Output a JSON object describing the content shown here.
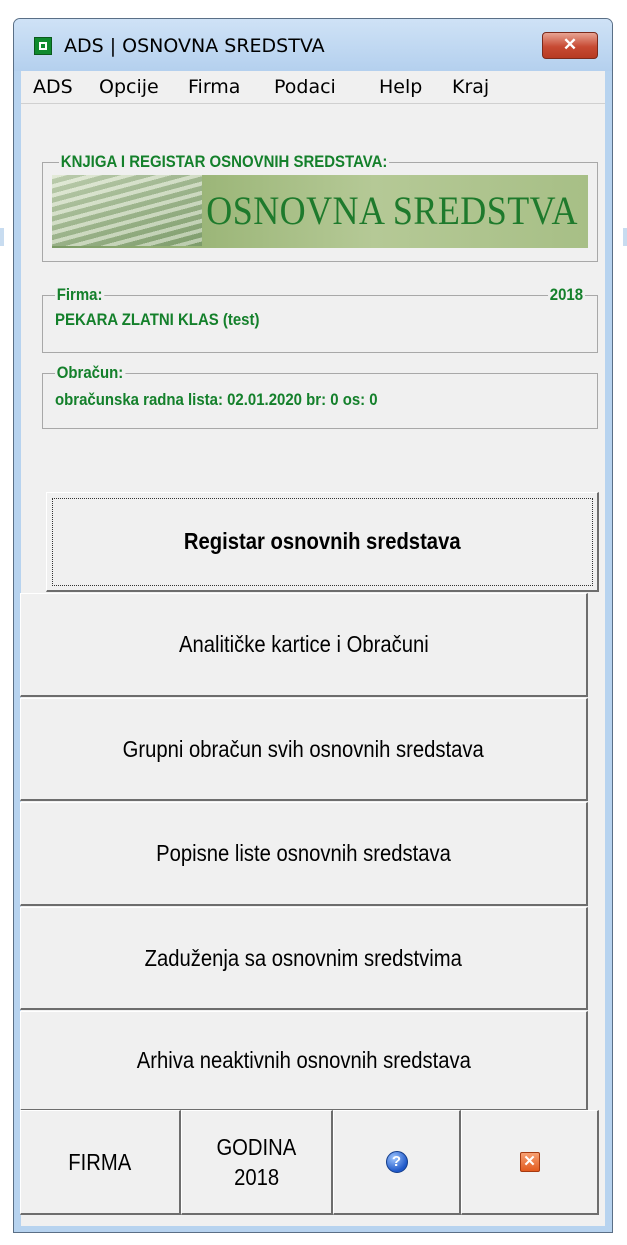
{
  "window": {
    "title": "ADS | OSNOVNA SREDSTVA",
    "close_glyph": "✕"
  },
  "menu": [
    "ADS",
    "Opcije",
    "Firma",
    "Podaci",
    "Help",
    "Kraj"
  ],
  "book": {
    "legend": "KNJIGA I REGISTAR OSNOVNIH SREDSTAVA:",
    "banner_text": "OSNOVNA SREDSTVA"
  },
  "firma": {
    "legend": "Firma:",
    "year": "2018",
    "name": "PEKARA ZLATNI KLAS (test)"
  },
  "obracun": {
    "legend": "Obračun:",
    "value": "obračunska radna lista: 02.01.2020 br: 0 os: 0"
  },
  "buttons": [
    "Registar osnovnih sredstava",
    "Analitičke kartice i Obračuni",
    "Grupni obračun svih osnovnih sredstava",
    "Popisne liste osnovnih sredstava",
    "Zaduženja sa osnovnim sredstvima",
    "Arhiva neaktivnih osnovnih sredstava"
  ],
  "bottom": {
    "firma": "FIRMA",
    "godina_line1": "GODINA",
    "godina_line2": "2018",
    "help_glyph": "?",
    "exit_glyph": "✕"
  },
  "colors": {
    "accent_green": "#14802b",
    "title_bar": "#b7d3ef",
    "close_red": "#c74a33"
  }
}
